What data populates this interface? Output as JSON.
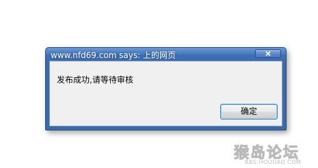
{
  "dialog": {
    "title": "www.nfd69.com says: 上的网页",
    "message": "发布成功,请等待审核",
    "ok_label": "确定"
  },
  "watermark": {
    "main": "猴岛论坛",
    "sub": "BBS.HOUDAO.COM"
  }
}
